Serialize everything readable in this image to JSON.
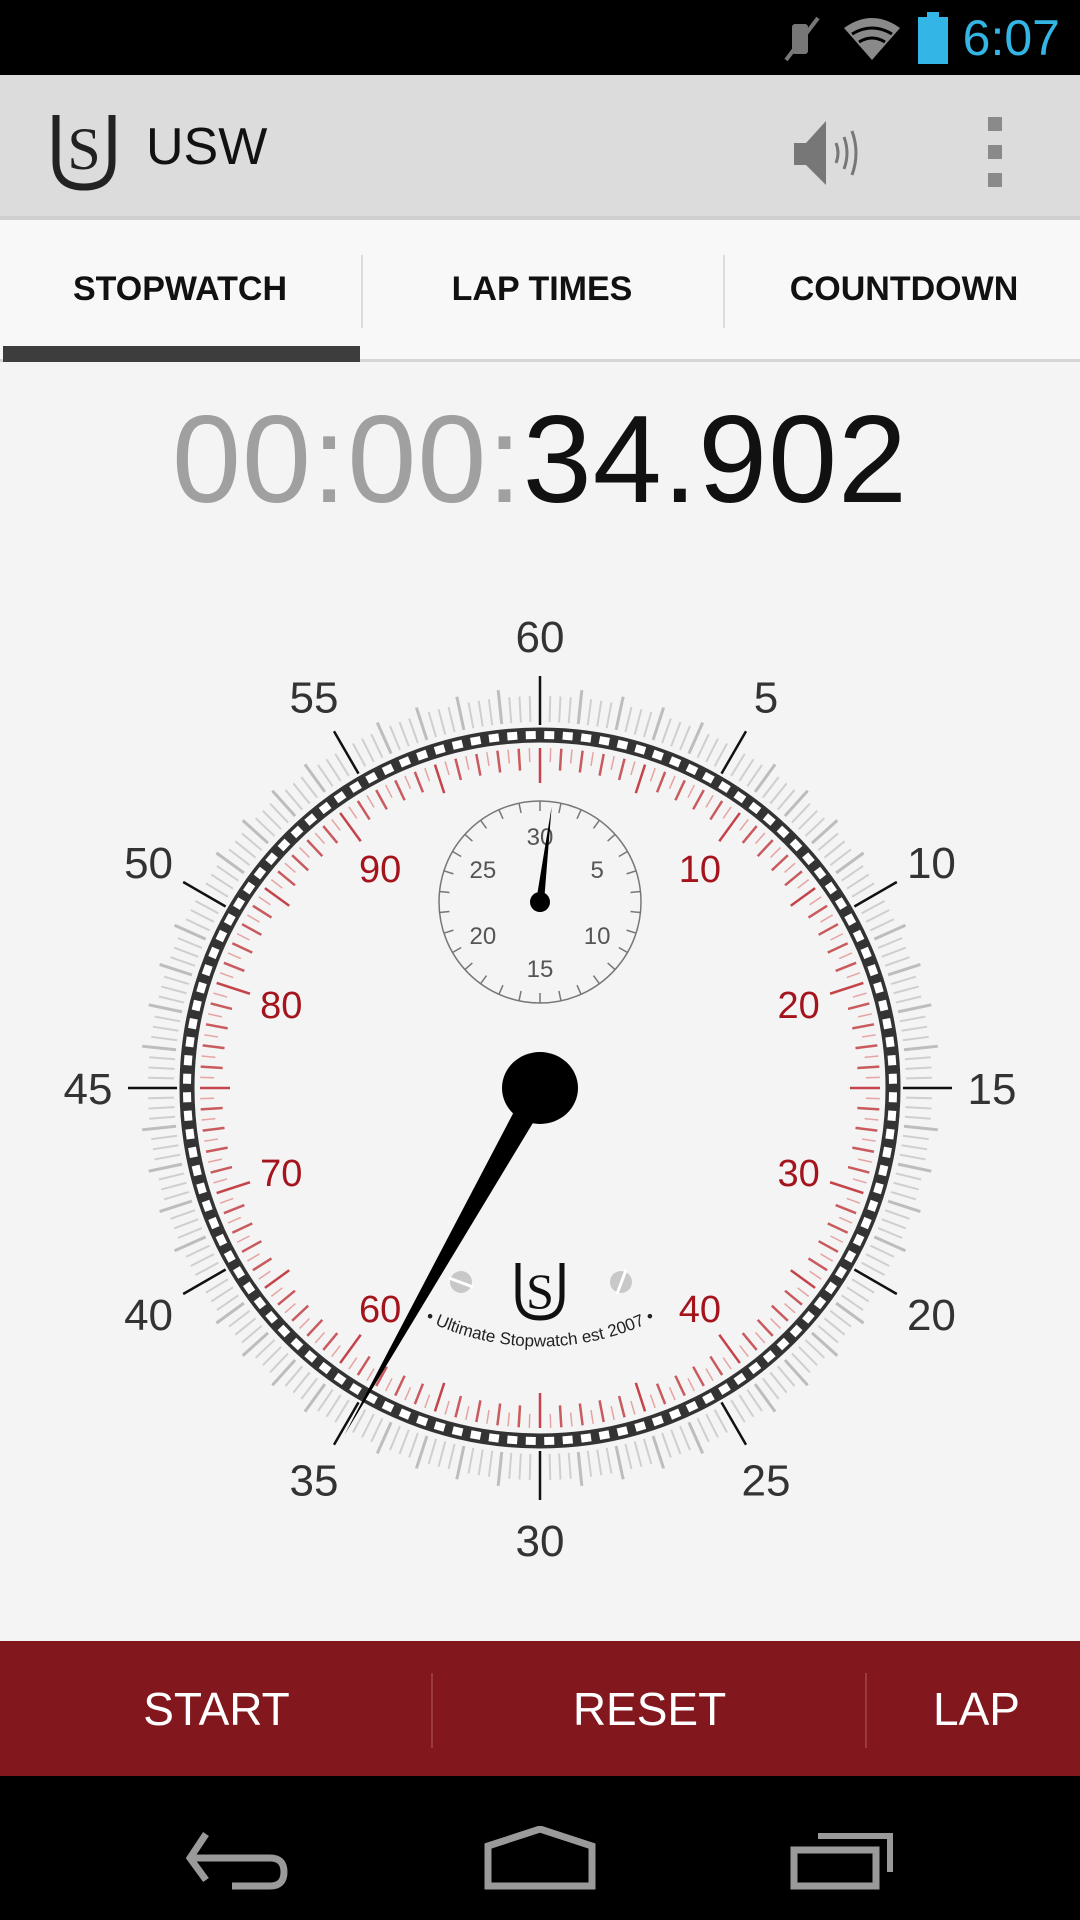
{
  "status_bar": {
    "time": "6:07",
    "icons": [
      "vibrate-mute-icon",
      "wifi-icon",
      "battery-icon"
    ],
    "accent_color": "#33b5e5"
  },
  "action_bar": {
    "title": "USW",
    "icons": [
      "usw-logo-icon",
      "speaker-icon",
      "overflow-menu-icon"
    ]
  },
  "tabs": [
    {
      "label": "STOPWATCH",
      "selected": true
    },
    {
      "label": "LAP TIMES",
      "selected": false
    },
    {
      "label": "COUNTDOWN",
      "selected": false
    }
  ],
  "timer": {
    "elapsed_prefix": "00:00:",
    "elapsed_seconds": "34.902"
  },
  "dial": {
    "seconds_value": 34.902,
    "minutes_value": 0.58,
    "outer_labels": [
      "60",
      "5",
      "10",
      "15",
      "20",
      "25",
      "30",
      "35",
      "40",
      "45",
      "50",
      "55"
    ],
    "inner_labels": [
      "10",
      "20",
      "30",
      "40",
      "60",
      "70",
      "80",
      "90"
    ],
    "inner_label_values": [
      10,
      20,
      30,
      40,
      60,
      70,
      80,
      90
    ],
    "sub_labels": [
      "30",
      "5",
      "10",
      "15",
      "20",
      "25"
    ],
    "brand_text": "• Ultimate Stopwatch est 2007 •",
    "inner_scale_color": "#a3141c"
  },
  "buttons": {
    "start": "START",
    "reset": "RESET",
    "lap": "LAP",
    "bar_color": "#82171e"
  },
  "nav": {
    "icons": [
      "back-icon",
      "home-icon",
      "recents-icon"
    ]
  }
}
